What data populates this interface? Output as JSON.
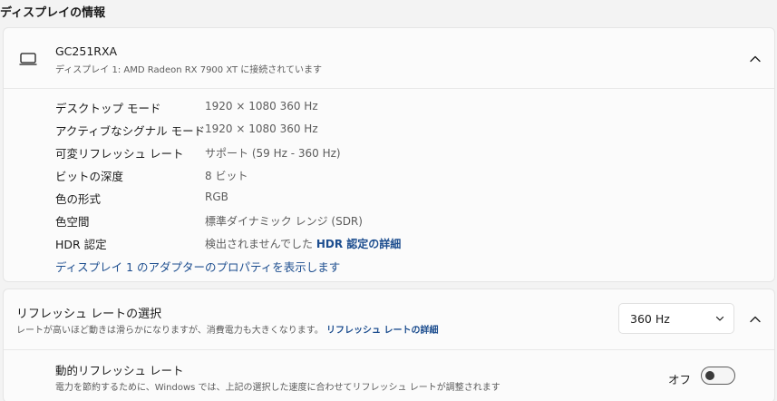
{
  "section_title": "ディスプレイの情報",
  "display": {
    "name": "GC251RXA",
    "subtitle": "ディスプレイ 1: AMD Radeon RX 7900 XT に接続されています",
    "properties": [
      {
        "label": "デスクトップ モード",
        "value": "1920 × 1080 360 Hz"
      },
      {
        "label": "アクティブなシグナル モード",
        "value": "1920 × 1080 360 Hz"
      },
      {
        "label": "可変リフレッシュ レート",
        "value": "サポート (59 Hz - 360 Hz)"
      },
      {
        "label": "ビットの深度",
        "value": "8 ビット"
      },
      {
        "label": "色の形式",
        "value": "RGB"
      },
      {
        "label": "色空間",
        "value": "標準ダイナミック レンジ (SDR)"
      },
      {
        "label": "HDR 認定",
        "value": "検出されませんでした",
        "link": "HDR 認定の詳細"
      }
    ],
    "adapter_link": "ディスプレイ 1 のアダプターのプロパティを表示します",
    "icon": "monitor-icon"
  },
  "refresh": {
    "title": "リフレッシュ レートの選択",
    "description": "レートが高いほど動きは滑らかになりますが、消費電力も大きくなります。",
    "link": "リフレッシュ レートの詳細",
    "selected": "360 Hz"
  },
  "dynamic_refresh": {
    "title": "動的リフレッシュ レート",
    "description": "電力を節約するために、Windows では、上記の選択した速度に合わせてリフレッシュ レートが調整されます",
    "toggle_label": "オフ",
    "enabled": false
  },
  "colors": {
    "background": "#f3f3f3",
    "card": "#fbfbfb",
    "link": "#1d4e8f"
  }
}
